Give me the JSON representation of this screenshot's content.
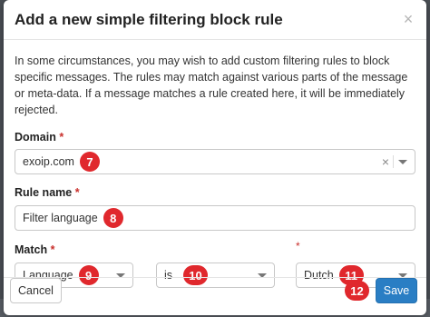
{
  "dialog": {
    "title": "Add a new simple filtering block rule",
    "close_glyph": "×",
    "intro": "In some circumstances, you may wish to add custom filtering rules to block specific messages. The rules may match against various parts of the message or meta-data. If a message matches a rule created here, it will be immediately rejected."
  },
  "domain": {
    "label": "Domain",
    "required_mark": "*",
    "value": "exoip.com",
    "clear_glyph": "×",
    "badge": "7"
  },
  "rule_name": {
    "label": "Rule name",
    "required_mark": "*",
    "value": "Filter language",
    "badge": "8"
  },
  "match": {
    "label": "Match",
    "required_mark": "*",
    "field": {
      "value": "Language",
      "badge": "9"
    },
    "operator": {
      "value": "is",
      "badge": "10"
    },
    "value_required_mark": "*",
    "value_select": {
      "value": "Dutch",
      "badge": "11"
    }
  },
  "footer": {
    "cancel_label": "Cancel",
    "save_label": "Save",
    "save_badge": "12"
  },
  "colors": {
    "badge": "#e0282d",
    "primary": "#2a7ec4",
    "required": "#c9302c"
  }
}
